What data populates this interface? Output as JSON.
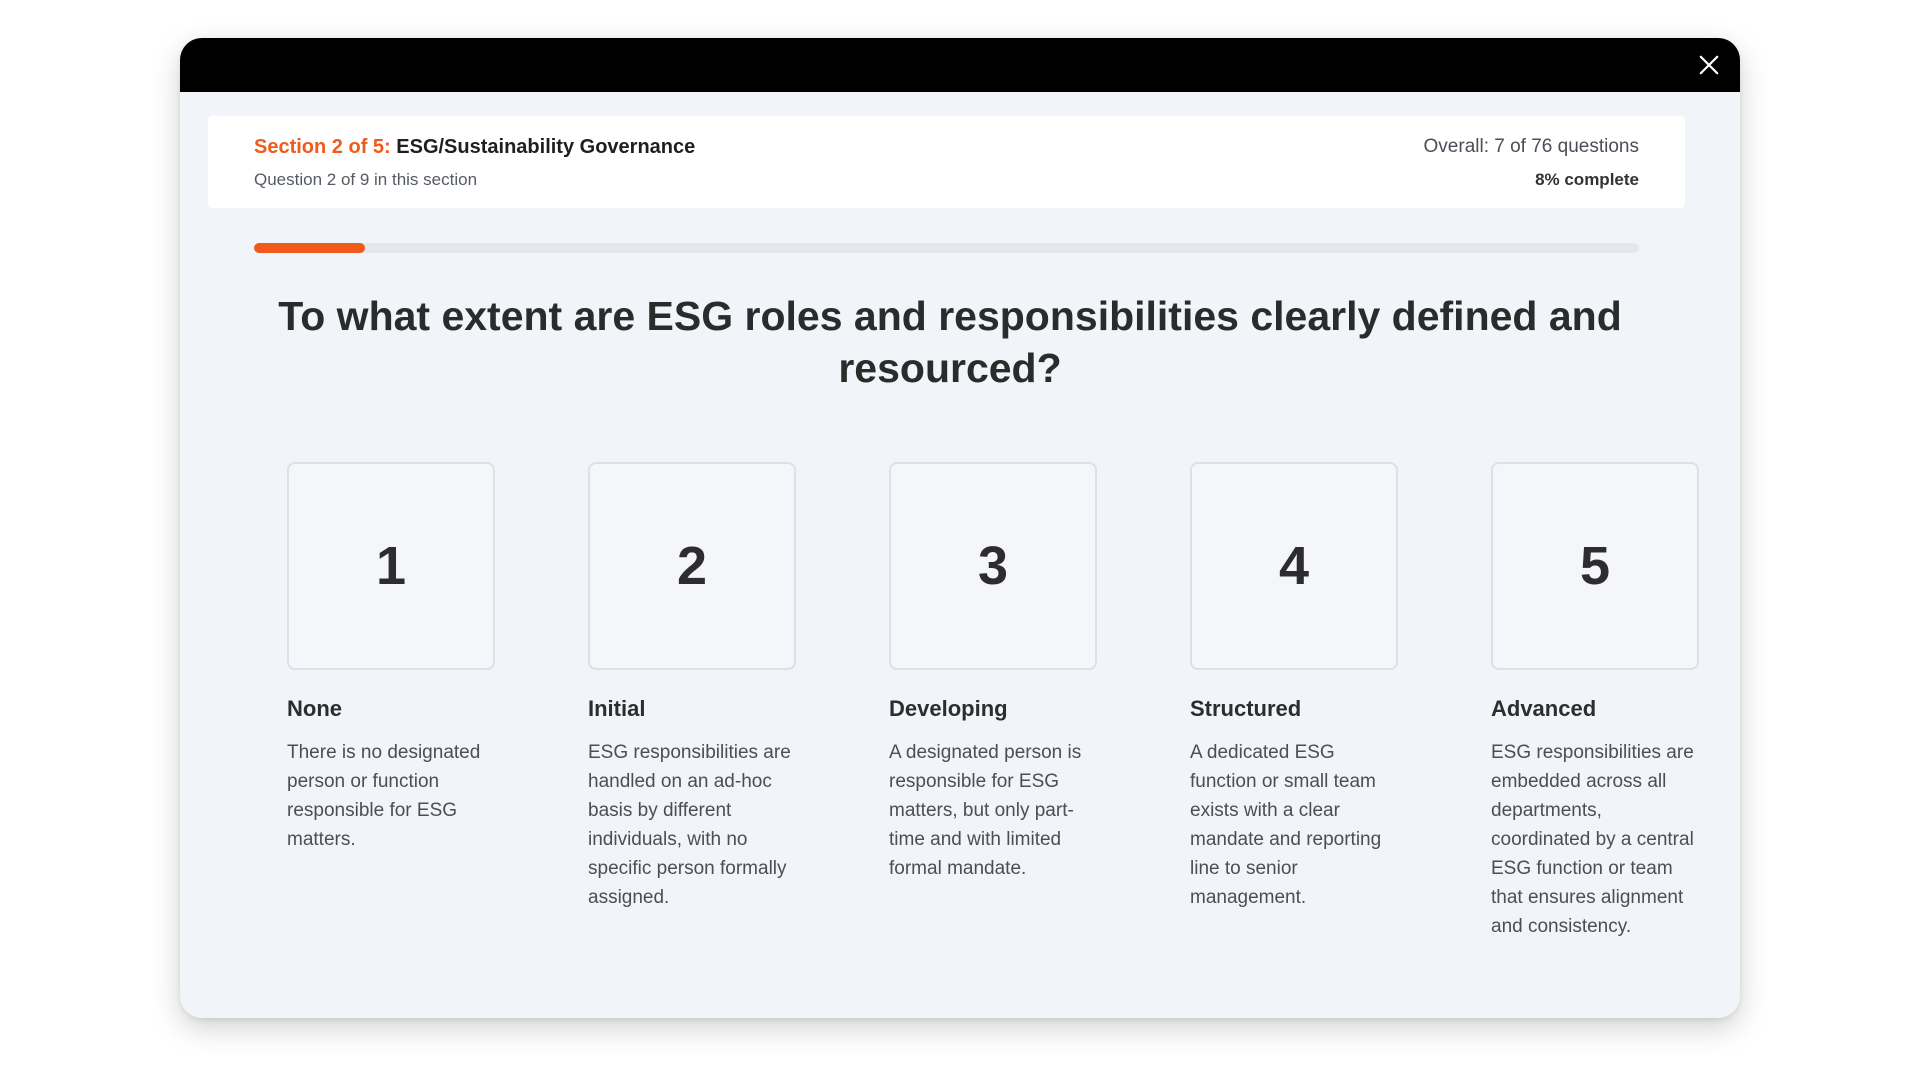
{
  "header": {
    "section_prefix": "Section 2 of 5:",
    "section_title": "ESG/Sustainability Governance",
    "question_position": "Question 2 of 9 in this section",
    "overall": "Overall: 7 of 76 questions",
    "percent_complete": "8% complete"
  },
  "progress": {
    "fraction": 0.08
  },
  "question": "To what extent are ESG roles and responsibilities clearly defined and resourced?",
  "options": [
    {
      "number": "1",
      "title": "None",
      "description": "There is no designated person or function responsible for ESG matters."
    },
    {
      "number": "2",
      "title": "Initial",
      "description": "ESG responsibilities are handled on an ad-hoc basis by different individuals, with no specific person formally assigned."
    },
    {
      "number": "3",
      "title": "Developing",
      "description": "A designated person is responsible for ESG matters, but only part-time and with limited formal mandate."
    },
    {
      "number": "4",
      "title": "Structured",
      "description": "A dedicated ESG function or small team exists with a clear mandate and reporting line to senior management."
    },
    {
      "number": "5",
      "title": "Advanced",
      "description": "ESG responsibilities are embedded across all departments, coordinated by a central ESG function or team that ensures alignment and consistency."
    }
  ],
  "colors": {
    "accent": "#f05a1a",
    "topbar": "#000000",
    "modal_bg": "#f1f4f9"
  },
  "icons": {
    "close": "close-icon"
  }
}
